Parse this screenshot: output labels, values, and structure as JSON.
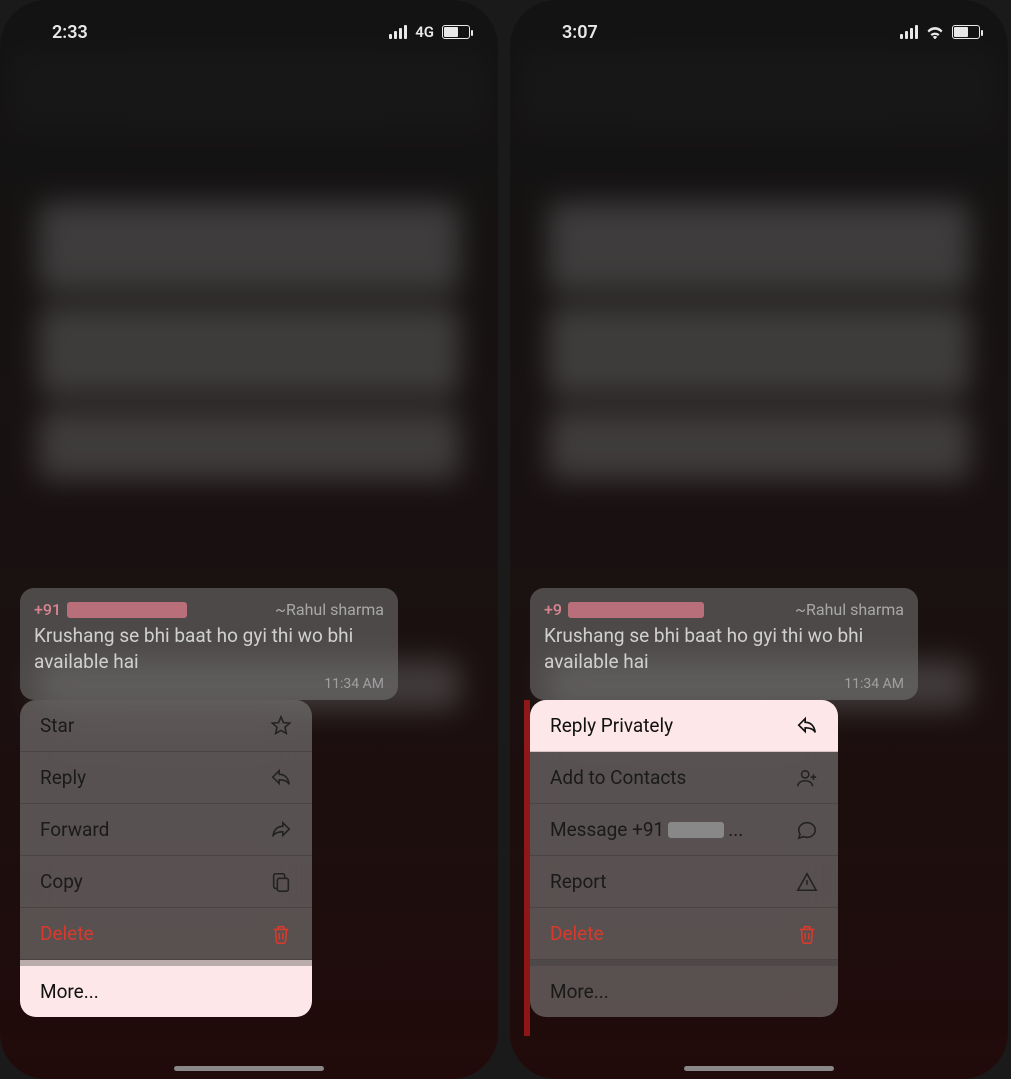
{
  "left": {
    "status": {
      "time": "2:33",
      "network": "4G"
    },
    "message": {
      "sender_prefix": "+91",
      "sender_name": "~Rahul sharma",
      "text": "Krushang se bhi baat ho gyi thi wo bhi available hai",
      "time": "11:34 AM"
    },
    "menu": {
      "star": "Star",
      "reply": "Reply",
      "forward": "Forward",
      "copy": "Copy",
      "delete": "Delete",
      "more": "More..."
    }
  },
  "right": {
    "status": {
      "time": "3:07"
    },
    "message": {
      "sender_prefix": "+9",
      "sender_name": "~Rahul sharma",
      "text": "Krushang se bhi baat ho gyi thi wo bhi available hai",
      "time": "11:34 AM"
    },
    "menu": {
      "reply_privately": "Reply Privately",
      "add_contacts": "Add to Contacts",
      "message_prefix": "Message +91",
      "message_suffix": "...",
      "report": "Report",
      "delete": "Delete",
      "more": "More..."
    }
  }
}
